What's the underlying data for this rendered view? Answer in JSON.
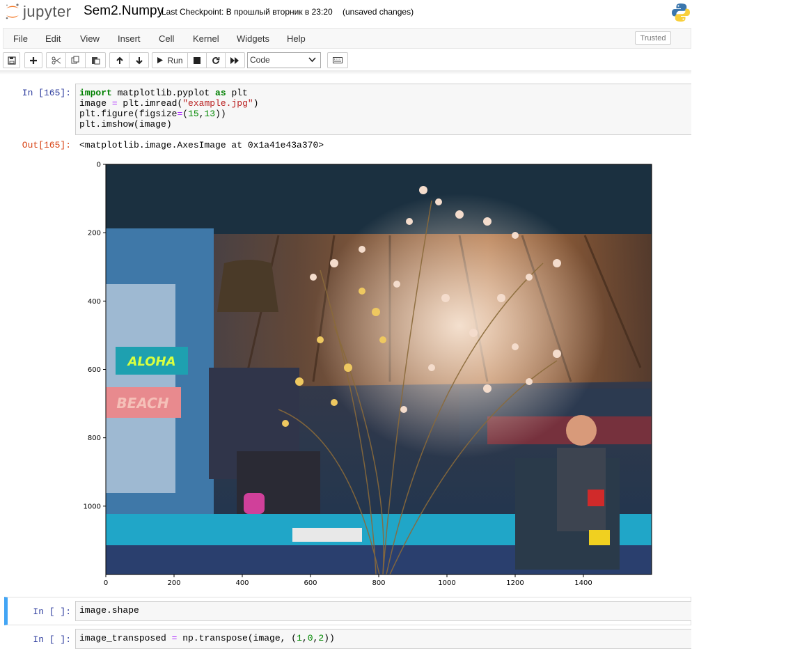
{
  "header": {
    "logo_text": "jupyter",
    "notebook_name": "Sem2.Numpy",
    "checkpoint": "Last Checkpoint: В прошлый вторник в 23:20",
    "unsaved": "(unsaved changes)"
  },
  "menubar": {
    "items": [
      "File",
      "Edit",
      "View",
      "Insert",
      "Cell",
      "Kernel",
      "Widgets",
      "Help"
    ],
    "trusted": "Trusted"
  },
  "toolbar": {
    "run_label": "Run",
    "cell_type": "Code",
    "icons": [
      "save-icon",
      "plus-icon",
      "scissors-icon",
      "copy-icon",
      "paste-icon",
      "arrow-up-icon",
      "arrow-down-icon",
      "play-icon",
      "stop-icon",
      "restart-icon",
      "fast-forward-icon",
      "keyboard-icon"
    ]
  },
  "cells": [
    {
      "prompt": "In [165]:",
      "lines": [
        "import matplotlib.pyplot as plt",
        "image = plt.imread(\"example.jpg\")",
        "plt.figure(figsize=(15,13))",
        "plt.imshow(image)"
      ],
      "out_prompt": "Out[165]:",
      "output": "<matplotlib.image.AxesImage at 0x1a41e43a370>"
    },
    {
      "prompt": "In [ ]:",
      "source": "image.shape"
    },
    {
      "prompt": "In [ ]:",
      "source": "image_transposed = np.transpose(image, (1,0,2))"
    }
  ],
  "plot": {
    "x_ticks": [
      0,
      200,
      400,
      600,
      800,
      1000,
      1200,
      1400
    ],
    "y_ticks": [
      0,
      200,
      400,
      600,
      800,
      1000
    ],
    "x_range": [
      0,
      1600
    ],
    "y_range": [
      0,
      1200
    ],
    "image_signs": [
      "ALOHA",
      "BEACH"
    ]
  }
}
